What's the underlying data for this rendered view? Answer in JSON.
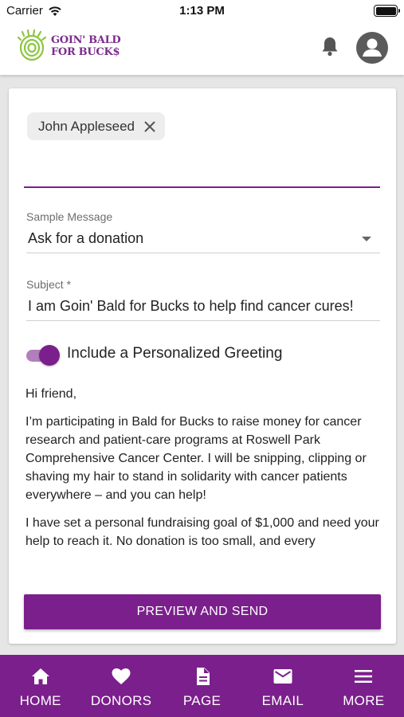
{
  "status_bar": {
    "carrier": "Carrier",
    "time": "1:13 PM"
  },
  "header": {
    "logo_line1": "GOIN' BALD",
    "logo_line2": "FOR BUCK$"
  },
  "recipient": {
    "name": "John Appleseed"
  },
  "sample_message": {
    "label": "Sample Message",
    "value": "Ask for a donation"
  },
  "subject": {
    "label": "Subject *",
    "value": "I am Goin' Bald for Bucks to help find cancer cures!"
  },
  "greeting_toggle": {
    "label": "Include a Personalized Greeting",
    "on": true
  },
  "message": {
    "greeting": "Hi friend,",
    "paragraph1": "I’m participating in Bald for Bucks to raise money for cancer research and patient-care programs at Roswell Park Comprehensive Cancer Center. I will be snipping, clipping or shaving my hair to stand in solidarity with cancer patients everywhere – and you can help!",
    "paragraph2": "I have set a personal fundraising goal of $1,000 and need your help to reach it. No donation is too small, and every"
  },
  "preview_button": {
    "label": "PREVIEW AND SEND"
  },
  "tabs": [
    {
      "label": "HOME",
      "icon": "home-icon"
    },
    {
      "label": "DONORS",
      "icon": "heart-icon"
    },
    {
      "label": "PAGE",
      "icon": "page-icon"
    },
    {
      "label": "EMAIL",
      "icon": "email-icon"
    },
    {
      "label": "MORE",
      "icon": "menu-icon"
    }
  ],
  "colors": {
    "brand": "#7b1f8c",
    "toggle_track": "#b27fbc",
    "logo_green": "#8cc63f"
  }
}
